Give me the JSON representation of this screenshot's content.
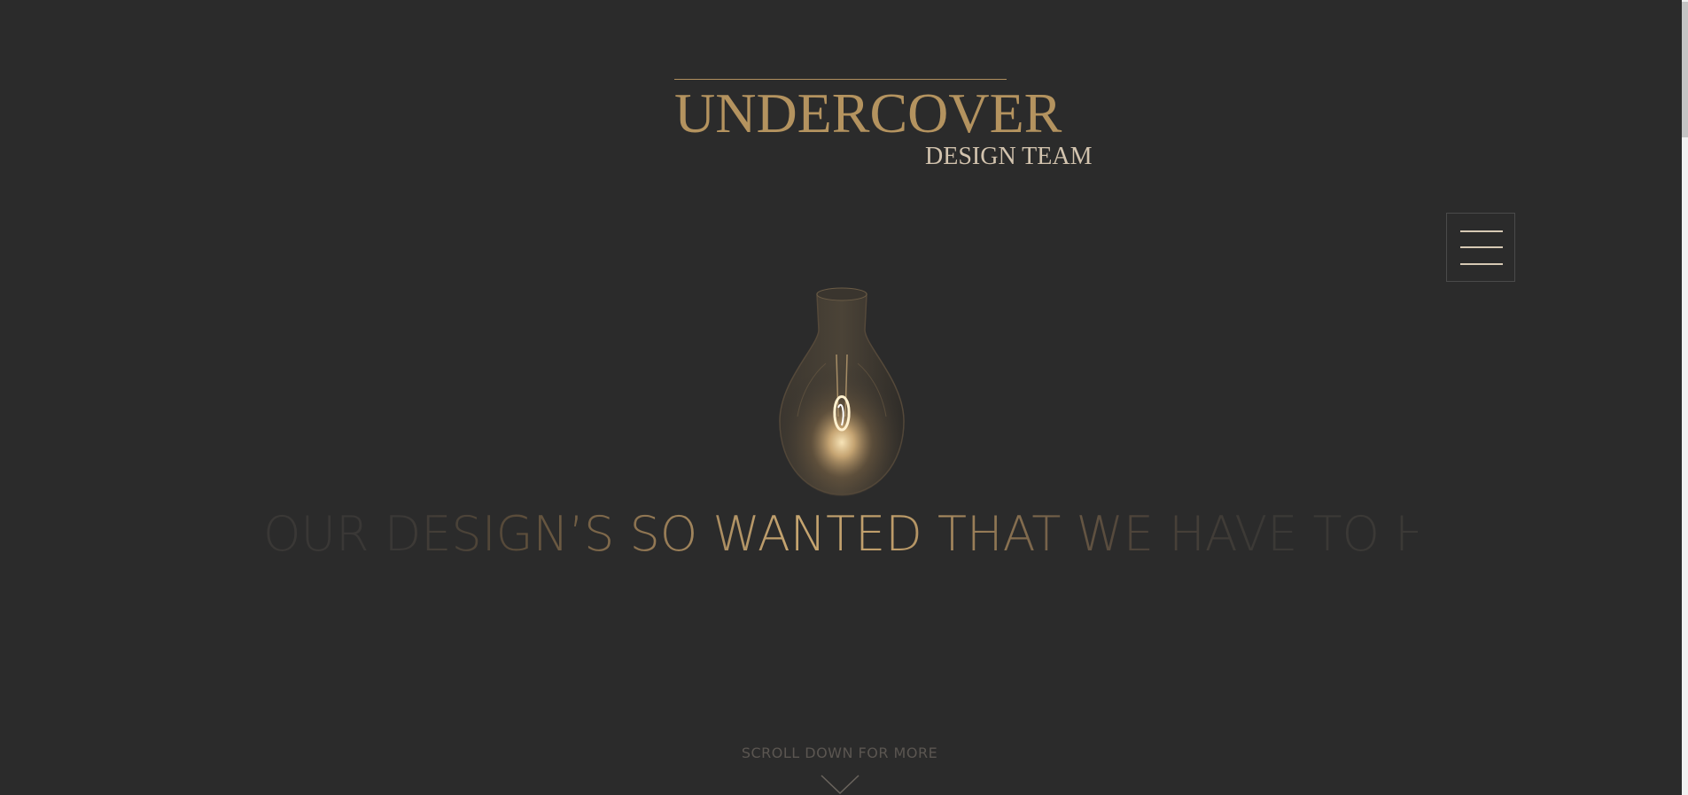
{
  "brand": {
    "title": "UNDERCOVER",
    "subtitle": "DESIGN TEAM"
  },
  "nav": {
    "menu_icon": "hamburger-menu-icon"
  },
  "hero": {
    "image_icon": "light-bulb-image",
    "headline": "OUR DESIGN’S SO WANTED THAT WE HAVE TO HIDE"
  },
  "footer": {
    "scroll_hint": "SCROLL DOWN FOR MORE",
    "scroll_icon": "chevron-down-icon"
  },
  "colors": {
    "background": "#2b2b2b",
    "accent_gold": "#b4935f",
    "subtitle_text": "#d2c3ae",
    "muted_text": "#5b5651"
  }
}
